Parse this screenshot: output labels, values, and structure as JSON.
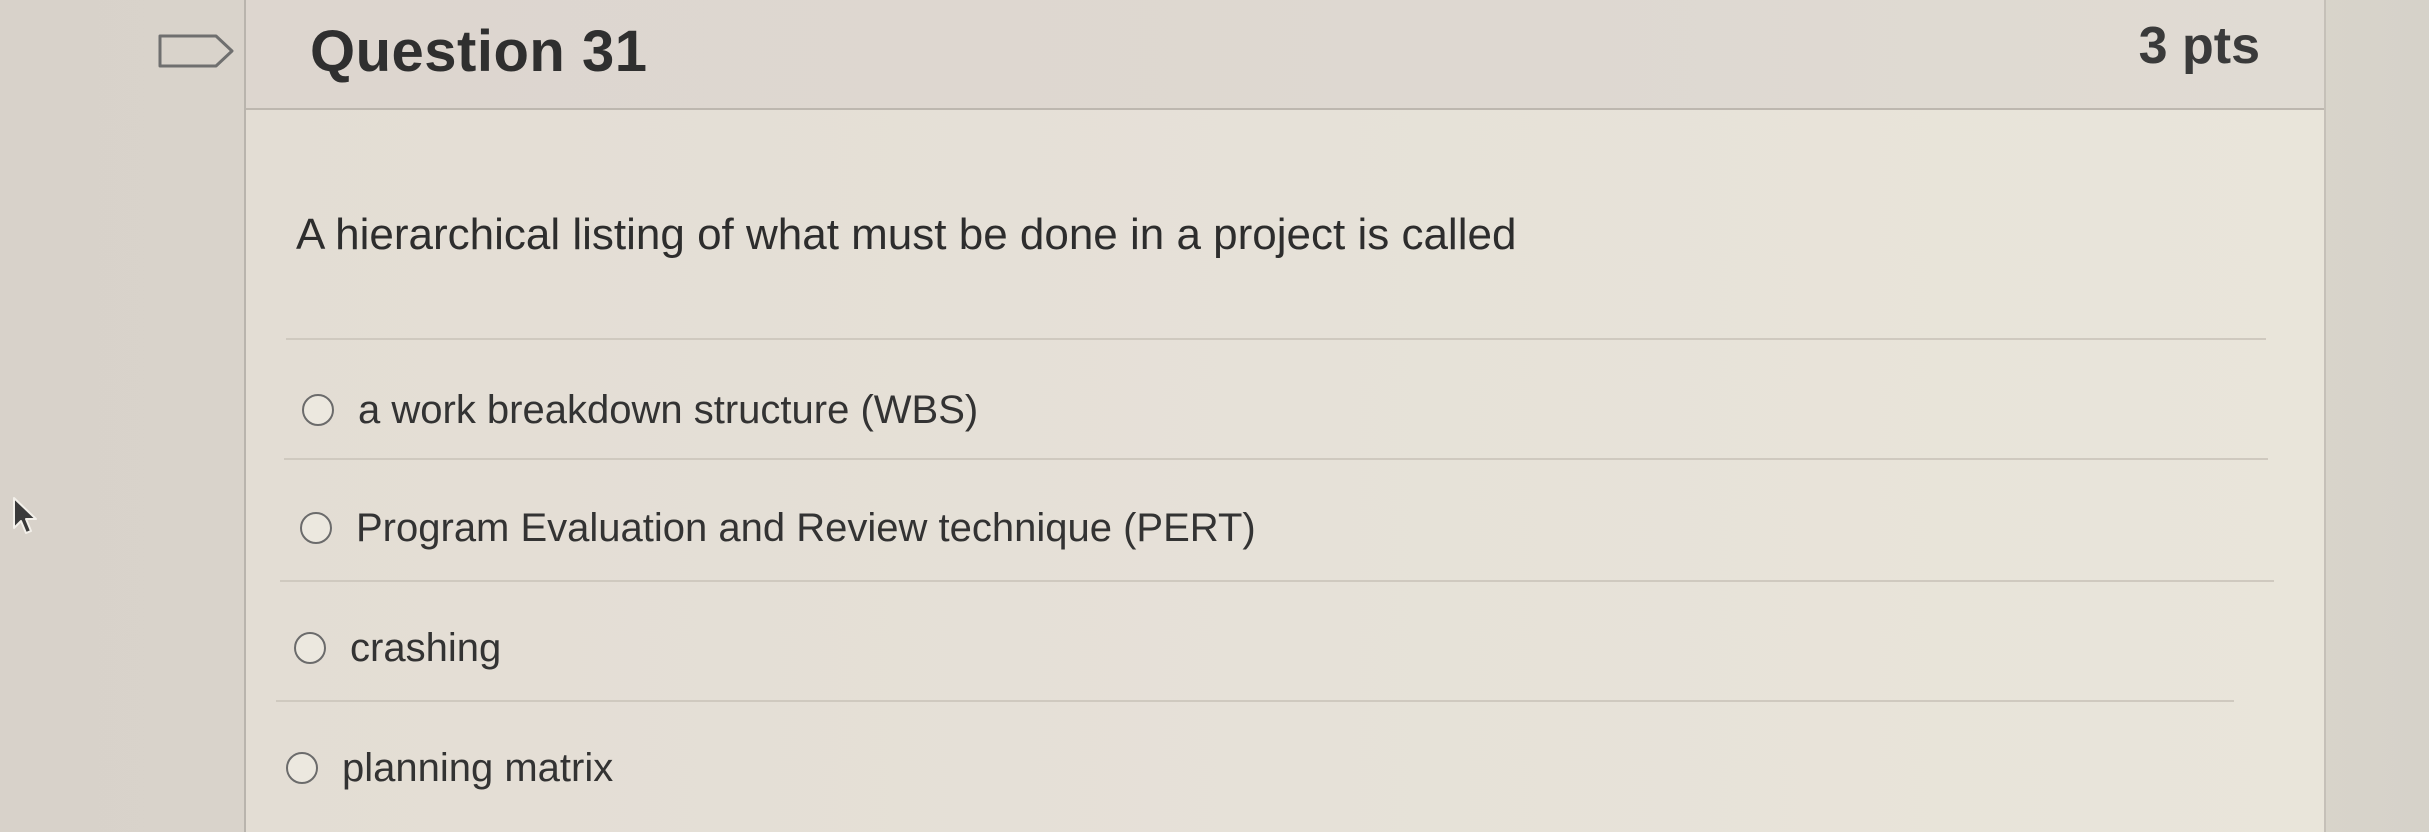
{
  "question": {
    "title": "Question 31",
    "points": "3 pts",
    "prompt": "A hierarchical listing of what must be done in a project is called",
    "answers": [
      {
        "label": "a work breakdown structure (WBS)",
        "selected": false
      },
      {
        "label": "Program Evaluation and Review technique (PERT)",
        "selected": false
      },
      {
        "label": "crashing",
        "selected": false
      },
      {
        "label": "planning matrix",
        "selected": false
      }
    ]
  },
  "icons": {
    "flag": "bookmark-flag-icon",
    "cursor": "mouse-pointer-icon"
  }
}
